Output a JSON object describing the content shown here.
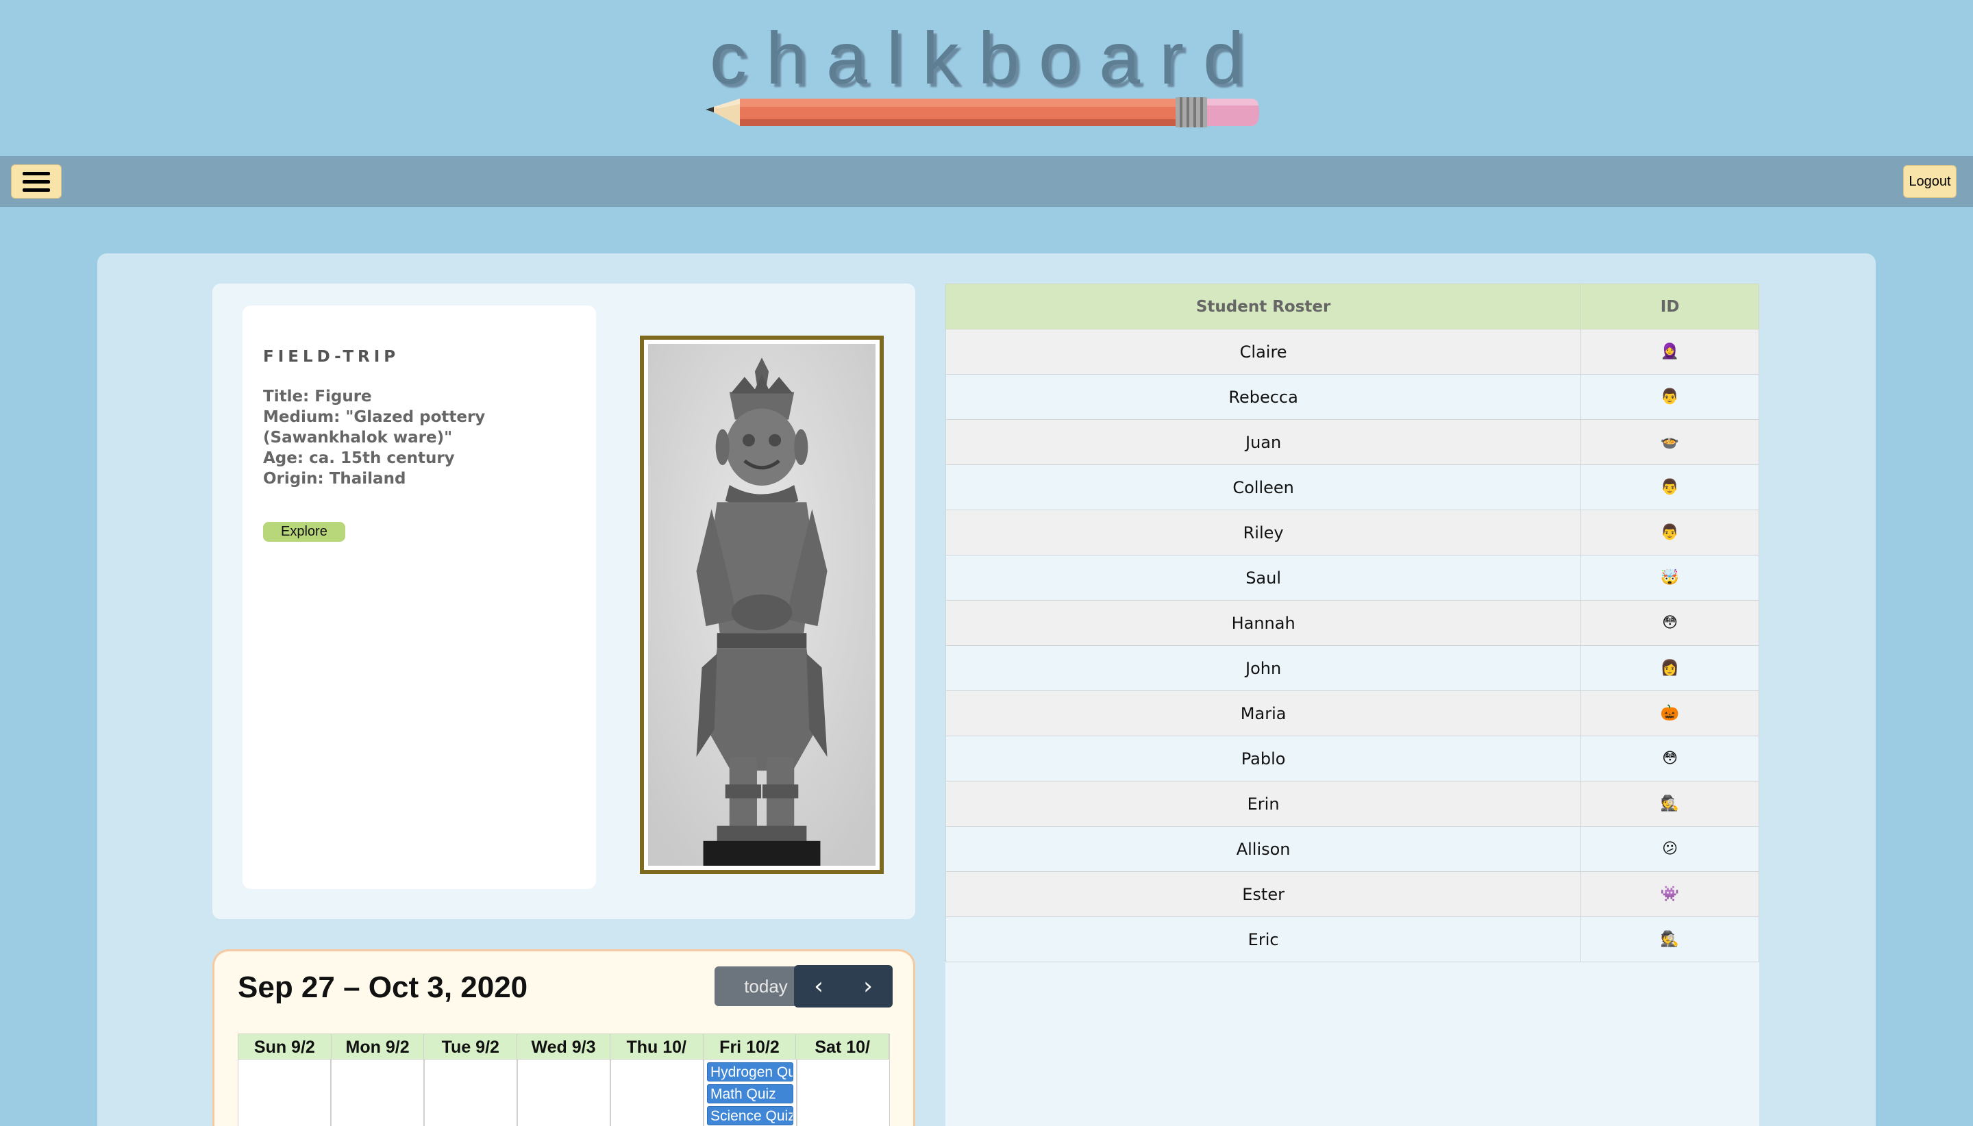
{
  "brand": {
    "title": "chalkboard"
  },
  "navbar": {
    "logout_label": "Logout"
  },
  "field_trip": {
    "heading": "FIELD-TRIP",
    "title_line": "Title: Figure",
    "medium_line_1": "Medium: \"Glazed pottery",
    "medium_line_2": "(Sawankhalok ware)\"",
    "age_line": "Age: ca. 15th century",
    "origin_line": "Origin: Thailand",
    "explore_label": "Explore"
  },
  "roster": {
    "col_name": "Student Roster",
    "col_id": "ID",
    "students": [
      {
        "name": "Claire",
        "id": "🧕"
      },
      {
        "name": "Rebecca",
        "id": "👨"
      },
      {
        "name": "Juan",
        "id": "🍲"
      },
      {
        "name": "Colleen",
        "id": "👨"
      },
      {
        "name": "Riley",
        "id": "👨"
      },
      {
        "name": "Saul",
        "id": "🤯"
      },
      {
        "name": "Hannah",
        "id": "😳"
      },
      {
        "name": "John",
        "id": "👩"
      },
      {
        "name": "Maria",
        "id": "🎃"
      },
      {
        "name": "Pablo",
        "id": "😳"
      },
      {
        "name": "Erin",
        "id": "🕵"
      },
      {
        "name": "Allison",
        "id": "😕"
      },
      {
        "name": "Ester",
        "id": "👾"
      },
      {
        "name": "Eric",
        "id": "🕵"
      }
    ]
  },
  "calendar": {
    "title": "Sep 27 – Oct 3, 2020",
    "today_label": "today",
    "prev_label": "‹",
    "next_label": "›",
    "days": [
      "Sun 9/2",
      "Mon 9/2",
      "Tue 9/2",
      "Wed 9/3",
      "Thu 10/",
      "Fri 10/2",
      "Sat 10/"
    ],
    "events": [
      "Hydrogen Qu",
      "Math Quiz",
      "Science Quiz"
    ]
  },
  "colors": {
    "background": "#9ccce4",
    "navbar": "#7fa3b8",
    "button_cream": "#f8e3a8",
    "explore_green": "#b8d77a",
    "roster_header": "#d6e8bf",
    "event_blue": "#3f86d6"
  }
}
